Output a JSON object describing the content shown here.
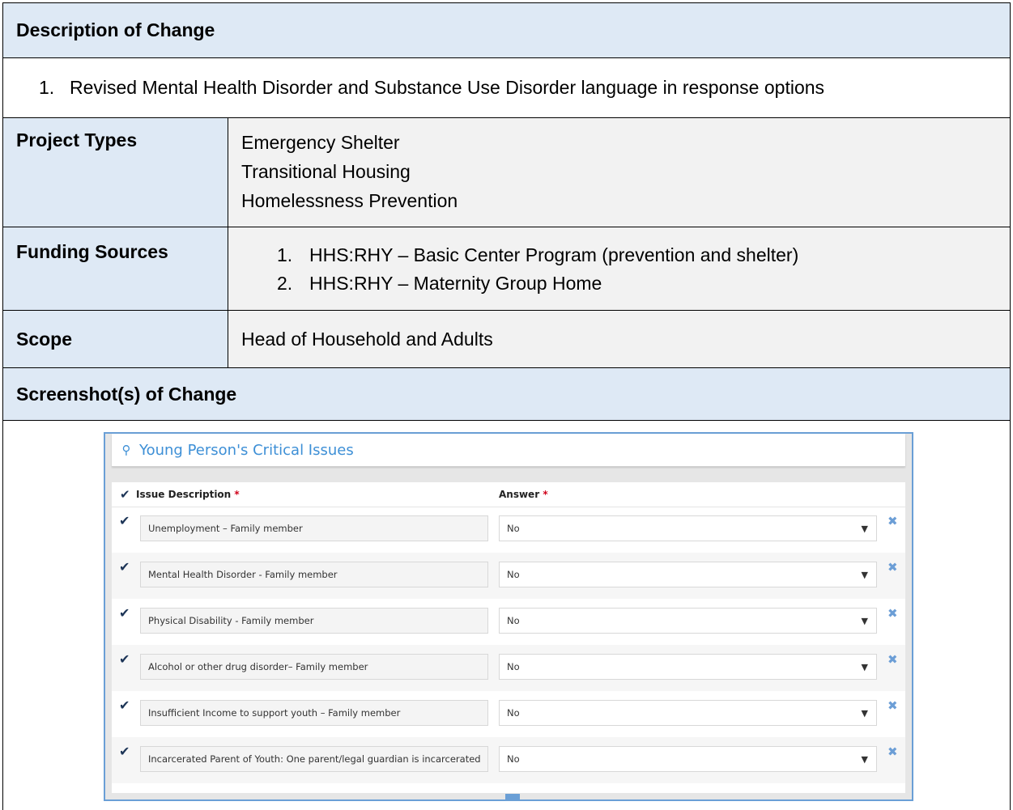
{
  "description": {
    "header": "Description of Change",
    "items": [
      {
        "num": "1.",
        "text": "Revised Mental Health Disorder and Substance Use Disorder language in response options"
      }
    ]
  },
  "project_types": {
    "label": "Project Types",
    "values": [
      "Emergency Shelter",
      "Transitional Housing",
      "Homelessness Prevention"
    ]
  },
  "funding_sources": {
    "label": "Funding Sources",
    "items": [
      {
        "num": "1.",
        "text": "HHS:RHY – Basic Center Program (prevention and shelter)"
      },
      {
        "num": "2.",
        "text": "HHS:RHY – Maternity Group Home"
      }
    ]
  },
  "scope": {
    "label": "Scope",
    "value": "Head of Household and Adults"
  },
  "screenshots_header": "Screenshot(s) of Change",
  "form": {
    "title": "Young Person's Critical Issues",
    "col_issue": "Issue Description",
    "col_answer": "Answer",
    "required_mark": "*",
    "rows": [
      {
        "issue": "Unemployment – Family member",
        "answer": "No"
      },
      {
        "issue": "Mental Health Disorder - Family member",
        "answer": "No"
      },
      {
        "issue": "Physical Disability - Family member",
        "answer": "No"
      },
      {
        "issue": "Alcohol or other drug disorder– Family member",
        "answer": "No"
      },
      {
        "issue": "Insufficient Income to support youth – Family member",
        "answer": "No"
      },
      {
        "issue": "Incarcerated Parent of Youth: One parent/legal guardian is incarcerated",
        "answer": "No"
      }
    ]
  }
}
